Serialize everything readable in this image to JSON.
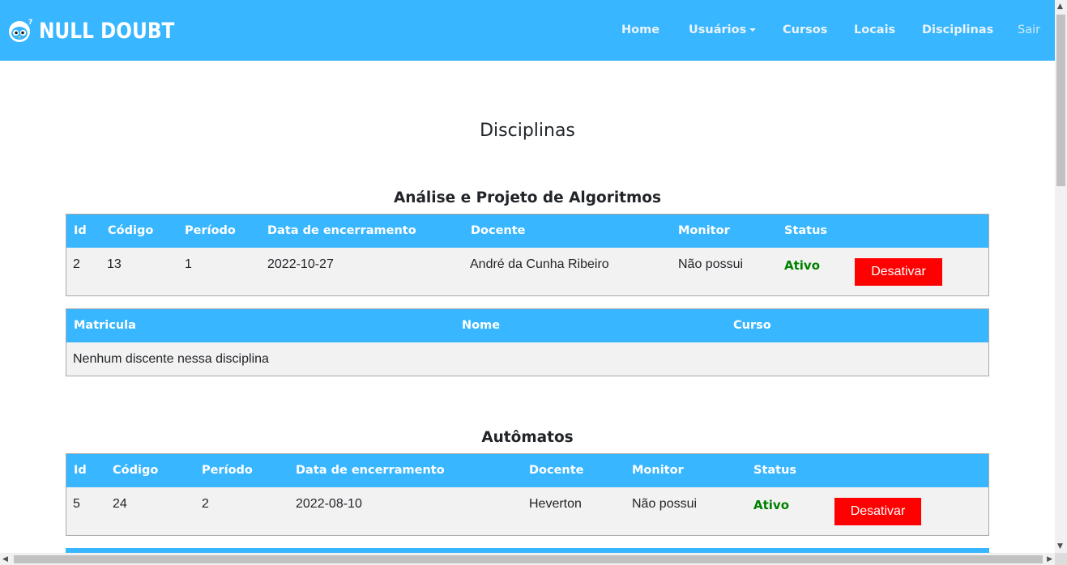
{
  "brand": {
    "name": "NULL DOUBT",
    "logo_icon": "penguin-icon"
  },
  "nav": {
    "home": "Home",
    "usuarios": "Usuários",
    "cursos": "Cursos",
    "locais": "Locais",
    "disciplinas": "Disciplinas",
    "sair": "Sair"
  },
  "colors": {
    "primary": "#38b6ff",
    "danger": "#ff0000",
    "active": "#008000",
    "row_bg": "#f2f2f2"
  },
  "page": {
    "title": "Disciplinas"
  },
  "disciplinas": [
    {
      "name": "Análise e Projeto de Algoritmos",
      "headers": [
        "Id",
        "Código",
        "Período",
        "Data de encerramento",
        "Docente",
        "Monitor",
        "Status"
      ],
      "row": {
        "id": "2",
        "codigo": "13",
        "periodo": "1",
        "data": "2022-10-27",
        "docente": "André da Cunha Ribeiro",
        "monitor": "Não possui",
        "status": "Ativo",
        "action": "Desativar"
      },
      "students": {
        "headers": [
          "Matricula",
          "Nome",
          "Curso"
        ],
        "empty": "Nenhum discente nessa disciplina"
      }
    },
    {
      "name": "Autômatos",
      "headers": [
        "Id",
        "Código",
        "Período",
        "Data de encerramento",
        "Docente",
        "Monitor",
        "Status"
      ],
      "row": {
        "id": "5",
        "codigo": "24",
        "periodo": "2",
        "data": "2022-08-10",
        "docente": "Heverton",
        "monitor": "Não possui",
        "status": "Ativo",
        "action": "Desativar"
      }
    }
  ]
}
